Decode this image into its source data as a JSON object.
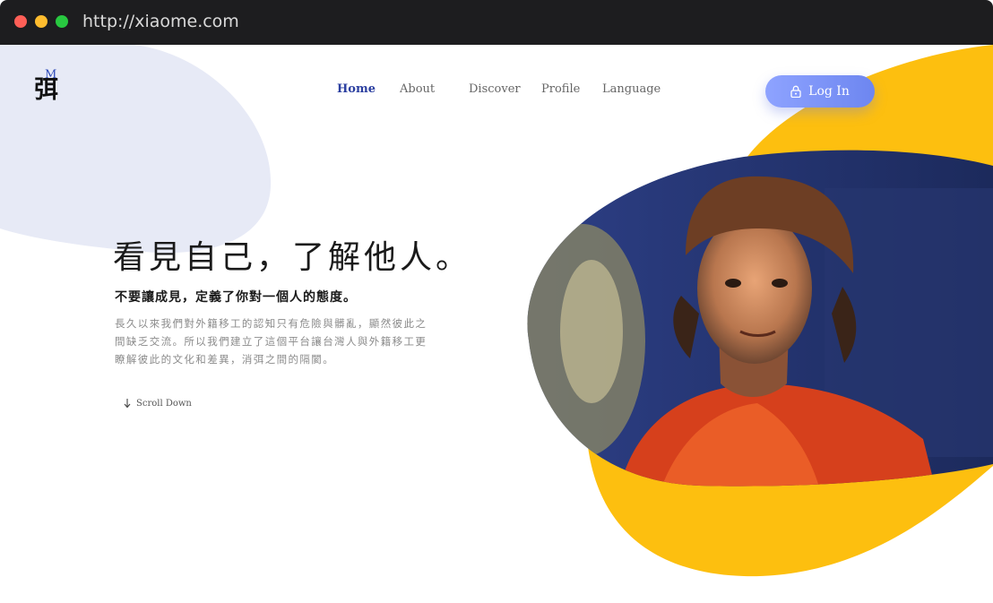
{
  "browser": {
    "url": "http://xiaome.com"
  },
  "logo": {
    "letter": "M",
    "character": "弭"
  },
  "nav": {
    "items": [
      {
        "label": "Home"
      },
      {
        "label": "About"
      },
      {
        "label": "Discover"
      },
      {
        "label": "Profile"
      },
      {
        "label": "Language"
      }
    ]
  },
  "login": {
    "label": "Log In"
  },
  "hero": {
    "headline": "看見自己，了解他人。",
    "subhead": "不要讓成見，定義了你對一個人的態度。",
    "body": "長久以來我們對外籍移工的認知只有危險與髒亂，顯然彼此之間缺乏交流。所以我們建立了這個平台讓台灣人與外籍移工更瞭解彼此的文化和差異，消弭之間的隔閡。",
    "scroll_label": "Scroll Down"
  },
  "colors": {
    "accent_blue": "#2b3fa0",
    "button_gradient": [
      "#8ea3ff",
      "#6d86f0"
    ],
    "yellow_blob": "#fdbf0f",
    "lavender_blob": "#e7eaf6",
    "photo_bg": "#2a3a7a"
  },
  "icons": {
    "lock": "lock-icon",
    "arrow_down": "arrow-down-icon"
  }
}
